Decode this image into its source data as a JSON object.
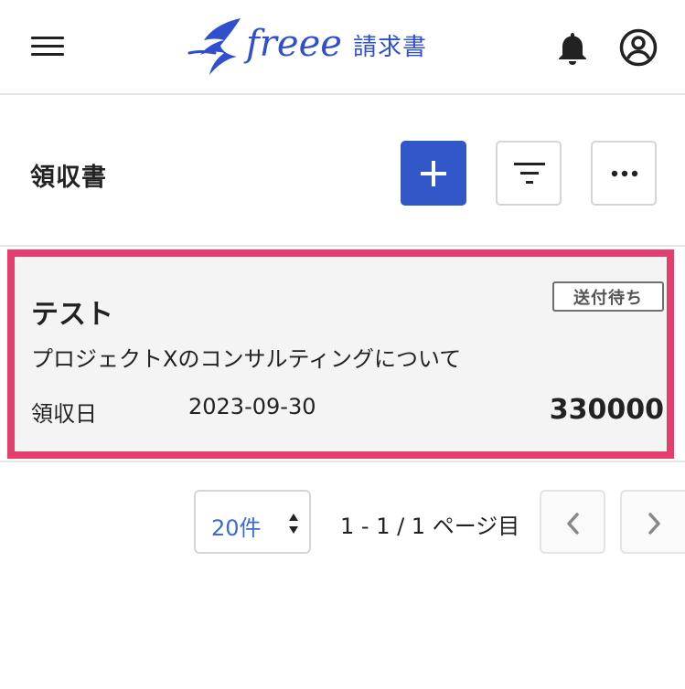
{
  "header": {
    "brand_word": "freee",
    "brand_product": "請求書",
    "icons": [
      "menu-icon",
      "freee-bird-logo",
      "bell-icon",
      "account-icon"
    ]
  },
  "page": {
    "title": "領収書",
    "actions": [
      "plus-icon",
      "filter-icon",
      "more-icon"
    ],
    "accent_color": "#3257c8",
    "highlight_color": "#e53d6e"
  },
  "receipts": [
    {
      "name": "テスト",
      "status": "送付待ち",
      "subject": "プロジェクトXのコンサルティングについて",
      "date_label": "領収日",
      "date": "2023-09-30",
      "amount": "330000"
    }
  ],
  "pagination": {
    "per_page": "20件",
    "range": "1 - 1 / 1 ページ目"
  }
}
